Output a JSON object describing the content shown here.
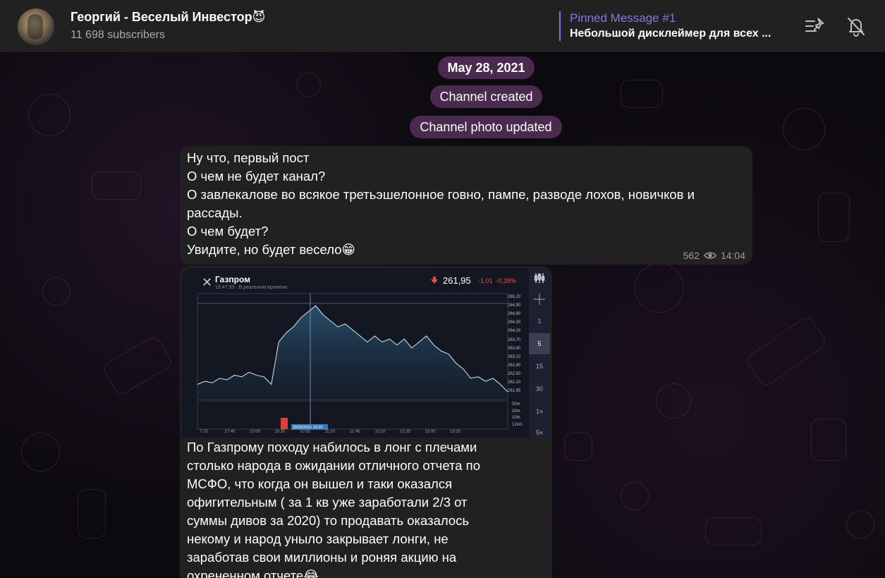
{
  "header": {
    "channel_title": "Георгий - Веселый Инвестор😈",
    "subscribers": "11 698 subscribers",
    "pinned_label": "Pinned Message #1",
    "pinned_text": "Небольшой дисклеймер для всех ..."
  },
  "service": {
    "date": "May 28, 2021",
    "created": "Channel created",
    "photo_updated": "Channel photo updated"
  },
  "messages": [
    {
      "lines": [
        "Ну что, первый пост",
        "О чем не будет канал?",
        "О завлекалове во всякое третьэшелонное говно, пампе, разводе лохов, новичков и",
        "рассады.",
        "О чем будет?",
        "Увидите, но будет весело😁"
      ],
      "views": "562",
      "time": "14:04"
    },
    {
      "lines": [
        "По Газпрому походу набилось в лонг с плечами",
        "столько народа в ожидании отличного отчета по",
        "МСФО, что когда он вышел и таки оказался",
        "офигительным ( за 1 кв уже заработали 2/3 от",
        "суммы дивов за 2020) то продавать оказалось",
        "некому и народ уныло закрывает лонги, не",
        "заработав свои миллионы и роняя акцию на",
        "охрененном отчете😂"
      ]
    }
  ],
  "chart_image": {
    "ticker": "Газпром",
    "time_note": "13:47:33 · В реальном времени",
    "price": "261,95",
    "change_abs": "-1,01",
    "change_pct": "-0,38%",
    "timeframes": [
      "1",
      "5",
      "15",
      "30",
      "1ч",
      "5ч"
    ],
    "active_timeframe": "5",
    "y_ticks": [
      "265,20",
      "264,90",
      "264,60",
      "264,30",
      "264,00",
      "263,70",
      "263,40",
      "263,10",
      "262,80",
      "262,50",
      "262,20",
      "261,95"
    ],
    "x_ticks": [
      "7:15",
      "17:40",
      "10:05",
      "10:30",
      "10:55",
      "11:20",
      "11:45",
      "12:10",
      "12:35",
      "13:00",
      "13:25"
    ],
    "cursor_date": "28/05/2021 10:20",
    "vol_ticks": [
      "30m",
      "20m",
      "10m",
      "12km"
    ],
    "price_series": [
      262.3,
      262.4,
      262.35,
      262.5,
      262.45,
      262.6,
      262.55,
      262.7,
      262.6,
      262.55,
      262.3,
      263.7,
      264.0,
      264.2,
      264.5,
      264.7,
      264.9,
      264.6,
      264.4,
      264.2,
      264.3,
      264.1,
      263.9,
      263.7,
      263.9,
      263.7,
      263.8,
      263.6,
      263.8,
      263.5,
      263.7,
      263.9,
      263.6,
      263.4,
      263.3,
      263.0,
      262.8,
      262.5,
      262.55,
      262.4,
      262.5,
      262.3,
      262.05
    ]
  },
  "colors": {
    "accent": "#8774e1",
    "service_bubble": "#4a2b4f",
    "bubble": "#212121",
    "negative": "#f0474f"
  }
}
